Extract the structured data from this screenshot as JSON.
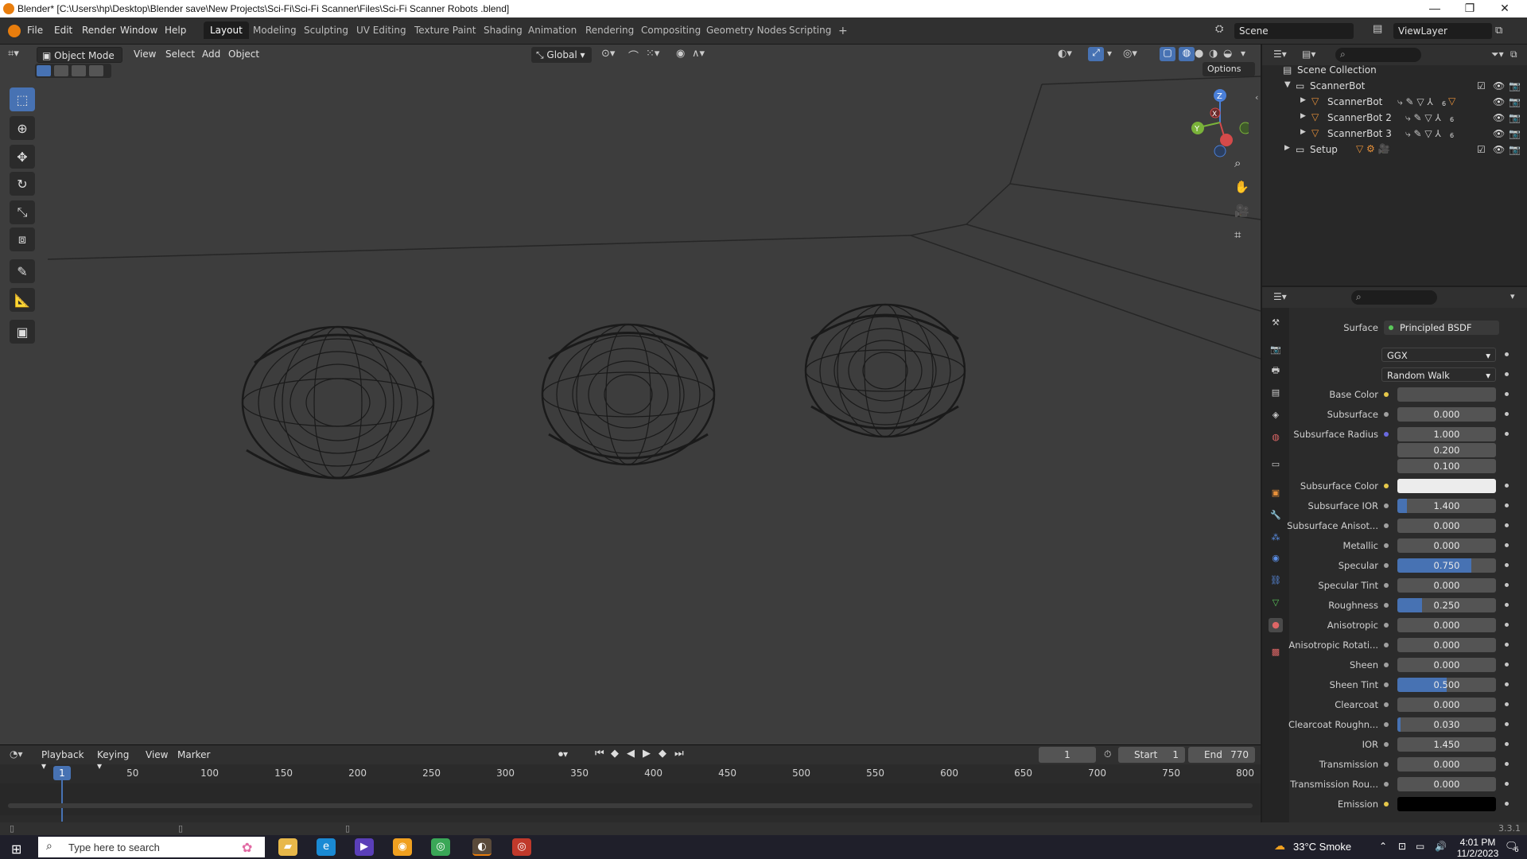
{
  "window": {
    "title": "Blender* [C:\\Users\\hp\\Desktop\\Blender save\\New Projects\\Sci-Fi\\Sci-Fi Scanner\\Files\\Sci-Fi Scanner Robots .blend]",
    "controls": [
      "—",
      "❐",
      "✕"
    ]
  },
  "menubar": {
    "menus": [
      "File",
      "Edit",
      "Render",
      "Window",
      "Help"
    ],
    "workspaces": [
      "Layout",
      "Modeling",
      "Sculpting",
      "UV Editing",
      "Texture Paint",
      "Shading",
      "Animation",
      "Rendering",
      "Compositing",
      "Geometry Nodes",
      "Scripting"
    ],
    "active_workspace": "Layout",
    "add_tab": "+",
    "scene": "Scene",
    "view_layer": "ViewLayer"
  },
  "viewport_header": {
    "mode": "Object Mode",
    "menus": [
      "View",
      "Select",
      "Add",
      "Object"
    ],
    "orientation": "Global",
    "options": "Options"
  },
  "toolbar": {
    "tools": [
      "select-box",
      "cursor",
      "move",
      "rotate",
      "scale",
      "transform",
      "annotate",
      "measure",
      "add-cube"
    ],
    "active_tool": "select-box"
  },
  "gizmo": {
    "axes": [
      "Z",
      "Y",
      "X"
    ]
  },
  "outliner": {
    "search_placeholder": "",
    "root": "Scene Collection",
    "items": [
      {
        "name": "ScannerBot",
        "level": 1,
        "expanded": true
      },
      {
        "name": "ScannerBot",
        "level": 2,
        "expanded": false
      },
      {
        "name": "ScannerBot 2",
        "level": 2,
        "expanded": false
      },
      {
        "name": "ScannerBot 3",
        "level": 2,
        "expanded": false
      },
      {
        "name": "Setup",
        "level": 1,
        "expanded": false
      }
    ],
    "subbadges": [
      "6",
      "6",
      "6"
    ]
  },
  "properties": {
    "surface_label": "Surface",
    "surface_value": "Principled BSDF",
    "distribution": "GGX",
    "subsurface_method": "Random Walk",
    "rows": [
      {
        "label": "Base Color",
        "type": "color",
        "color": "#505050",
        "dot": "#e6c84a"
      },
      {
        "label": "Subsurface",
        "type": "value",
        "value": "0.000",
        "fill": 0,
        "dot": "#a0a0a0"
      },
      {
        "label": "Subsurface Radius",
        "type": "vector",
        "values": [
          "1.000",
          "0.200",
          "0.100"
        ],
        "dot": "#6a6ae0"
      },
      {
        "label": "Subsurface Color",
        "type": "color",
        "color": "#ececec",
        "dot": "#e6c84a"
      },
      {
        "label": "Subsurface IOR",
        "type": "value",
        "value": "1.400",
        "fill": 0.1,
        "dot": "#a0a0a0"
      },
      {
        "label": "Subsurface Anisot...",
        "type": "value",
        "value": "0.000",
        "fill": 0,
        "dot": "#a0a0a0"
      },
      {
        "label": "Metallic",
        "type": "value",
        "value": "0.000",
        "fill": 0,
        "dot": "#a0a0a0"
      },
      {
        "label": "Specular",
        "type": "value",
        "value": "0.750",
        "fill": 0.75,
        "dot": "#a0a0a0"
      },
      {
        "label": "Specular Tint",
        "type": "value",
        "value": "0.000",
        "fill": 0,
        "dot": "#a0a0a0"
      },
      {
        "label": "Roughness",
        "type": "value",
        "value": "0.250",
        "fill": 0.25,
        "dot": "#a0a0a0"
      },
      {
        "label": "Anisotropic",
        "type": "value",
        "value": "0.000",
        "fill": 0,
        "dot": "#a0a0a0"
      },
      {
        "label": "Anisotropic Rotati...",
        "type": "value",
        "value": "0.000",
        "fill": 0,
        "dot": "#a0a0a0"
      },
      {
        "label": "Sheen",
        "type": "value",
        "value": "0.000",
        "fill": 0,
        "dot": "#a0a0a0"
      },
      {
        "label": "Sheen Tint",
        "type": "value",
        "value": "0.500",
        "fill": 0.5,
        "dot": "#a0a0a0"
      },
      {
        "label": "Clearcoat",
        "type": "value",
        "value": "0.000",
        "fill": 0,
        "dot": "#a0a0a0"
      },
      {
        "label": "Clearcoat Roughn...",
        "type": "value",
        "value": "0.030",
        "fill": 0.03,
        "dot": "#a0a0a0"
      },
      {
        "label": "IOR",
        "type": "value",
        "value": "1.450",
        "fill": 0,
        "dot": "#a0a0a0"
      },
      {
        "label": "Transmission",
        "type": "value",
        "value": "0.000",
        "fill": 0,
        "dot": "#a0a0a0"
      },
      {
        "label": "Transmission Rou...",
        "type": "value",
        "value": "0.000",
        "fill": 0,
        "dot": "#a0a0a0"
      },
      {
        "label": "Emission",
        "type": "color",
        "color": "#000000",
        "dot": "#e6c84a"
      }
    ]
  },
  "timeline": {
    "menus": [
      "Playback",
      "Keying",
      "View",
      "Marker"
    ],
    "current_frame": "1",
    "start_label": "Start",
    "start": "1",
    "end_label": "End",
    "end": "770",
    "ticks": [
      "50",
      "100",
      "150",
      "200",
      "250",
      "300",
      "350",
      "400",
      "450",
      "500",
      "550",
      "600",
      "650",
      "700",
      "750",
      "800"
    ],
    "playhead": "1"
  },
  "statusbar": {
    "version": "3.3.1"
  },
  "taskbar": {
    "search_placeholder": "Type here to search",
    "weather": "33°C  Smoke",
    "time": "4:01 PM",
    "date": "11/2/2023",
    "notification_count": "6"
  },
  "colors": {
    "accent": "#4772b3",
    "header": "#303030",
    "viewport": "#3d3d3d",
    "panel": "#2b2b2b",
    "blender_orange": "#e87d0d"
  }
}
